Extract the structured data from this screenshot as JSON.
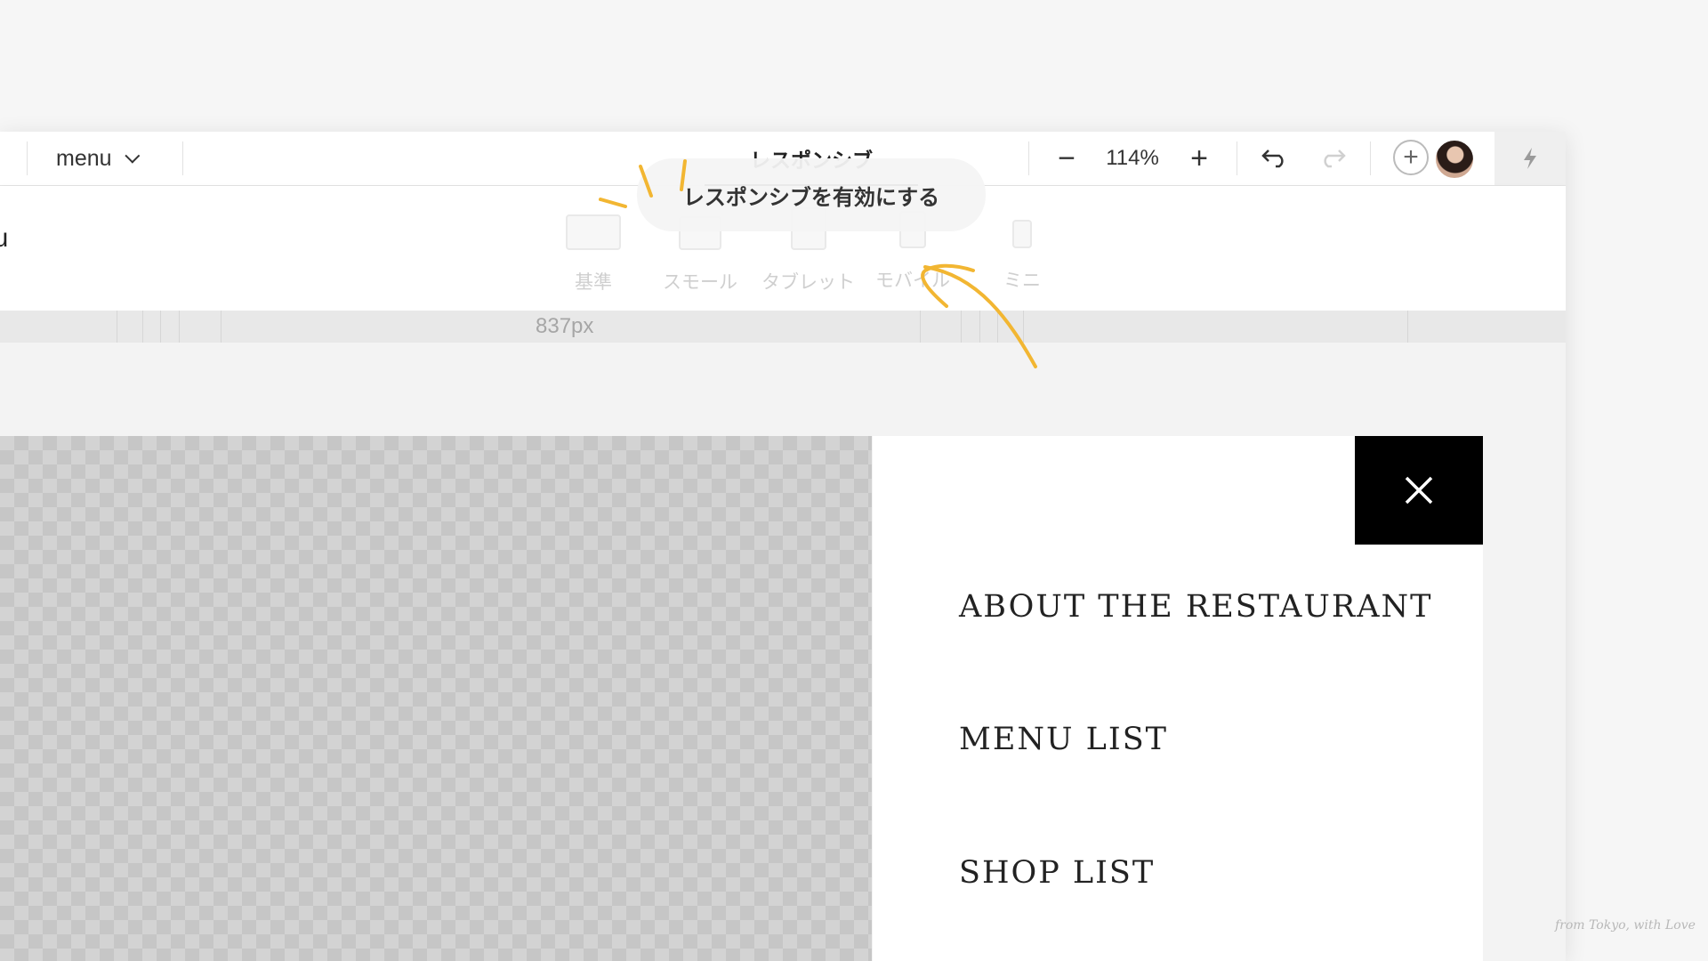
{
  "toolbar": {
    "page_select": "menu",
    "tab_label": "レスポンシブ",
    "zoom_out": "−",
    "zoom_value": "114%",
    "zoom_in": "+",
    "add": "+"
  },
  "subbar": {
    "element_name": "nu",
    "breakpoints": [
      {
        "label": "基準",
        "icon": "desktop-icon"
      },
      {
        "label": "スモール",
        "icon": "laptop-icon"
      },
      {
        "label": "タブレット",
        "icon": "tablet-icon"
      },
      {
        "label": "モバイル",
        "icon": "mobile-icon"
      },
      {
        "label": "ミニ",
        "icon": "mini-device-icon"
      }
    ],
    "enable_button": "レスポンシブを有効にする"
  },
  "ruler": {
    "label": "837px"
  },
  "menu": {
    "items": [
      "ABOUT THE RESTAURANT",
      "MENU LIST",
      "SHOP LIST"
    ]
  },
  "signature": "from Tokyo, with Love",
  "colors": {
    "accent_annotation": "#f2b632",
    "close_bg": "#000000"
  }
}
